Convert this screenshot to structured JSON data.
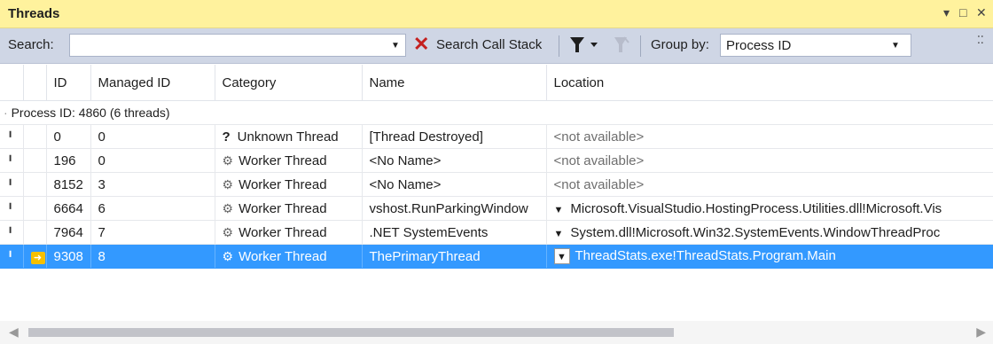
{
  "window": {
    "title": "Threads",
    "controls": {
      "menu": "▾",
      "maximize": "□",
      "close": "✕"
    }
  },
  "toolbar": {
    "search_label": "Search:",
    "search_value": "",
    "search_placeholder": "",
    "clear_search_glyph": "✕",
    "search_call_stack_label": "Search Call Stack",
    "group_by_label": "Group by:",
    "group_by_value": "Process ID"
  },
  "columns": {
    "flag": "",
    "current": "",
    "id": "ID",
    "managed_id": "Managed ID",
    "category": "Category",
    "name": "Name",
    "location": "Location"
  },
  "group": {
    "label": "Process ID: 4860  (6 threads)"
  },
  "rows": [
    {
      "id": "0",
      "managed_id": "0",
      "category": "Unknown Thread",
      "category_icon": "question-icon",
      "name": "[Thread Destroyed]",
      "location": "<not available>",
      "expandable": false,
      "current": false,
      "selected": false
    },
    {
      "id": "196",
      "managed_id": "0",
      "category": "Worker Thread",
      "category_icon": "gear-icon",
      "name": "<No Name>",
      "location": "<not available>",
      "expandable": false,
      "current": false,
      "selected": false
    },
    {
      "id": "8152",
      "managed_id": "3",
      "category": "Worker Thread",
      "category_icon": "gear-icon",
      "name": "<No Name>",
      "location": "<not available>",
      "expandable": false,
      "current": false,
      "selected": false
    },
    {
      "id": "6664",
      "managed_id": "6",
      "category": "Worker Thread",
      "category_icon": "gear-icon",
      "name": "vshost.RunParkingWindow",
      "location": "Microsoft.VisualStudio.HostingProcess.Utilities.dll!Microsoft.Vis",
      "expandable": true,
      "current": false,
      "selected": false
    },
    {
      "id": "7964",
      "managed_id": "7",
      "category": "Worker Thread",
      "category_icon": "gear-icon",
      "name": ".NET SystemEvents",
      "location": "System.dll!Microsoft.Win32.SystemEvents.WindowThreadProc",
      "expandable": true,
      "current": false,
      "selected": false
    },
    {
      "id": "9308",
      "managed_id": "8",
      "category": "Worker Thread",
      "category_icon": "gear-icon",
      "name": "ThePrimaryThread",
      "location": "ThreadStats.exe!ThreadStats.Program.Main",
      "expandable": true,
      "current": true,
      "selected": true
    }
  ],
  "colors": {
    "titlebar": "#fff29d",
    "toolbar": "#cfd6e5",
    "selection": "#3399ff",
    "clear_x": "#c4201f",
    "current_arrow": "#f6c000"
  }
}
